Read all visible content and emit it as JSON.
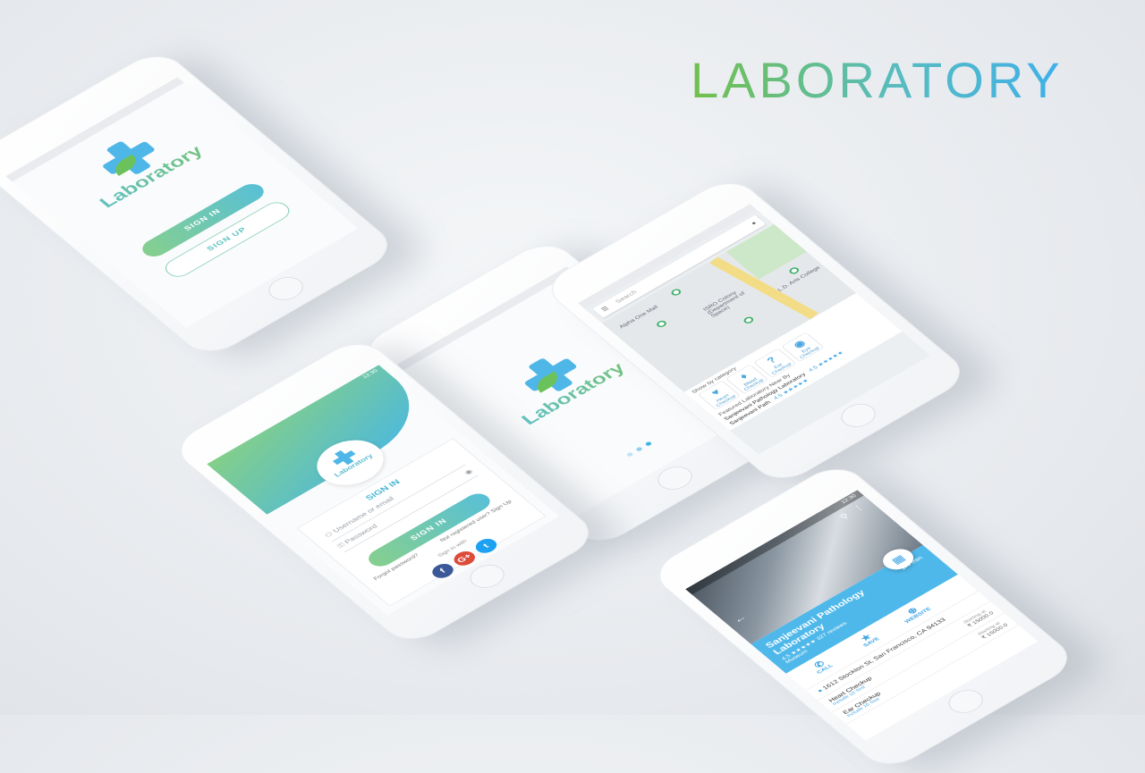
{
  "heading": "LABORATORY",
  "colors": {
    "green": "#72c04a",
    "teal": "#58bcc0",
    "blue": "#3fb0ea"
  },
  "brand": {
    "name": "Laboratory"
  },
  "auth_screen": {
    "sign_in": "SIGN IN",
    "sign_up": "SIGN UP"
  },
  "splash_screen": {
    "loading_dots": 3
  },
  "login_screen": {
    "time": "12:30",
    "title": "SIGN IN",
    "username_placeholder": "Username or email",
    "password_placeholder": "Password",
    "sign_in_button": "SIGN IN",
    "not_registered": "Not registered user? Sign Up",
    "forgot_password": "Forgot password?",
    "sign_in_with": "Sign in with",
    "social": [
      {
        "icon": "facebook-icon",
        "glyph": "f",
        "color": "#3b5998"
      },
      {
        "icon": "google-plus-icon",
        "glyph": "G+",
        "color": "#dd4b39"
      },
      {
        "icon": "twitter-icon",
        "glyph": "t",
        "color": "#1da1f2"
      }
    ]
  },
  "map_screen": {
    "search_placeholder": "Search",
    "places": [
      "Alpha One Mall",
      "ISRO Colony (Department of Space)",
      "L.D. Arts College"
    ],
    "show_by_category": "Show by category",
    "categories": [
      {
        "icon": "heart-icon",
        "glyph": "♥",
        "label": "Heart Checkup"
      },
      {
        "icon": "blood-icon",
        "glyph": "♦",
        "label": "Blood Checkup"
      },
      {
        "icon": "ear-icon",
        "glyph": "?",
        "label": "Ear Checkup"
      },
      {
        "icon": "eye-icon",
        "glyph": "◉",
        "label": "Eye Checkup"
      }
    ],
    "featured_title": "Featured Laboratory Near By",
    "featured": [
      {
        "name": "Sanjeevani Pathology Laboratory",
        "rating": "4.5 ★★★★★"
      },
      {
        "name": "Sanjeevani Path",
        "rating": "4.5 ★★★★★"
      }
    ]
  },
  "detail_screen": {
    "time": "12:30",
    "distance": "1.4 min",
    "name": "Sanjeevani Pathology Laboratory",
    "rating": "4.5",
    "stars": "★★★★★",
    "reviews": "327 reviews",
    "type": "Museum",
    "actions": [
      {
        "icon": "phone-icon",
        "glyph": "✆",
        "label": "CALL"
      },
      {
        "icon": "star-icon",
        "glyph": "★",
        "label": "SAVE"
      },
      {
        "icon": "globe-icon",
        "glyph": "⊕",
        "label": "WEBSITE"
      }
    ],
    "address": "1612 Stockton St, San Francisco, CA 94133",
    "tests": [
      {
        "name": "Heart Checkup",
        "sub": "Include 10 Test",
        "price": "₹ 15000.0",
        "price_label": "Starting at"
      },
      {
        "name": "Ear Checkup",
        "sub": "Include 10 Test",
        "price": "₹ 15000.0",
        "price_label": "Starting at"
      }
    ]
  }
}
